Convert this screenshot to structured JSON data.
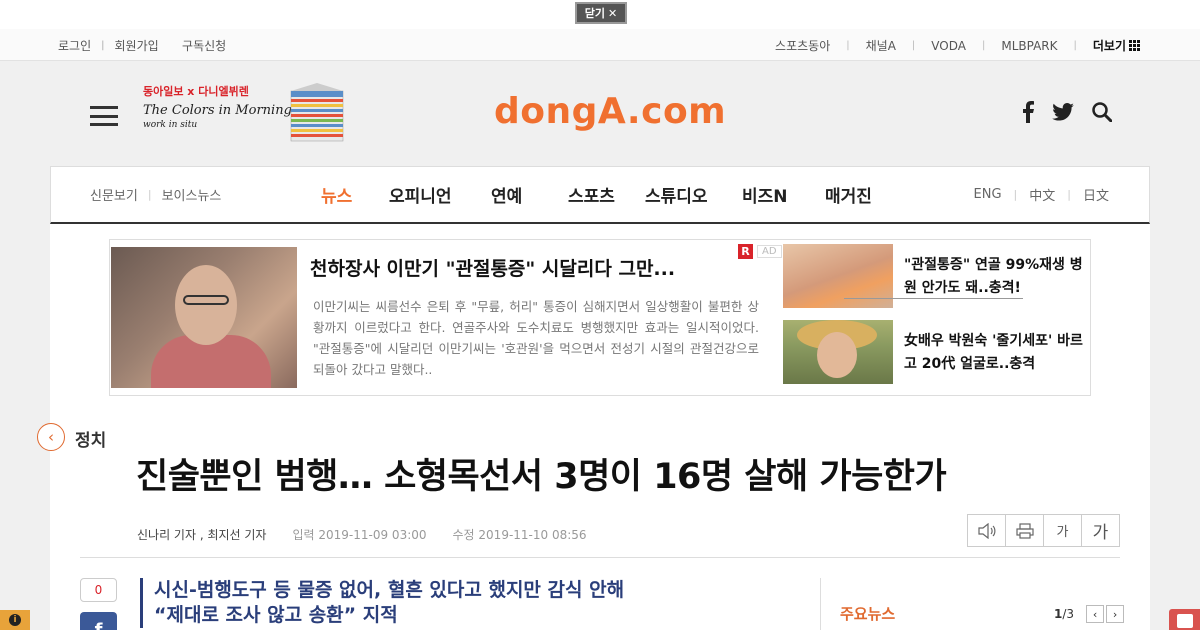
{
  "closebar": {
    "label": "닫기",
    "icon": "close-icon"
  },
  "util": {
    "left": [
      "로그인",
      "회원가입",
      "구독신청"
    ],
    "right": [
      "스포츠동아",
      "채널A",
      "VODA",
      "MLBPARK"
    ],
    "more": "더보기"
  },
  "header": {
    "promo_line1": "동아일보 x 다니엘뷔렌",
    "promo_line2": "The Colors in Morning Calm",
    "promo_line3": "work in situ",
    "logo": "dongA.com",
    "icons": [
      "facebook-icon",
      "twitter-icon",
      "search-icon"
    ]
  },
  "nav": {
    "left": [
      "신문보기",
      "보이스뉴스"
    ],
    "main": [
      "뉴스",
      "오피니언",
      "연예",
      "스포츠",
      "스튜디오",
      "비즈N",
      "매거진"
    ],
    "active": "뉴스",
    "right": [
      "ENG",
      "中文",
      "日文"
    ],
    "accent_color": "#f07030"
  },
  "ad": {
    "title": "천하장사 이만기 \"관절통증\" 시달리다 그만...",
    "desc": "이만기씨는 씨름선수 은퇴 후 \"무릎, 허리\" 통증이 심해지면서 일상행활이 불편한 상황까지 이르렀다고 한다. 연골주사와 도수치료도 병행했지만 효과는 일시적이었다. \"관절통증\"에 시달리던 이만기씨는 '호관원'을 먹으면서 전성기 시절의 관절건강으로 되돌아 갔다고 말했다..",
    "badge_r": "R",
    "badge_ad": "AD",
    "side1": "\"관절통증\" 연골 99%재생 병원 안가도 돼..충격!",
    "side2": "女배우 박원숙 '줄기세포' 바르고 20代 얼굴로..충격"
  },
  "article": {
    "section": "정치",
    "headline": "진술뿐인 범행… 소형목선서 3명이 16명 살해 가능한가",
    "byline": "신나리 기자 , 최지선 기자",
    "input_date": "입력 2019-11-09 03:00",
    "edit_date": "수정 2019-11-10 08:56",
    "tools": {
      "font_small": "가",
      "font_large": "가"
    },
    "share_count": "0",
    "subhead_1": "시신-범행도구 등 물증 없어, 혈흔 있다고 했지만 감식 안해",
    "subhead_2": "“제대로 조사 않고 송환” 지적"
  },
  "sidebar": {
    "title": "주요뉴스",
    "page_current": "1",
    "page_total": "/3"
  }
}
